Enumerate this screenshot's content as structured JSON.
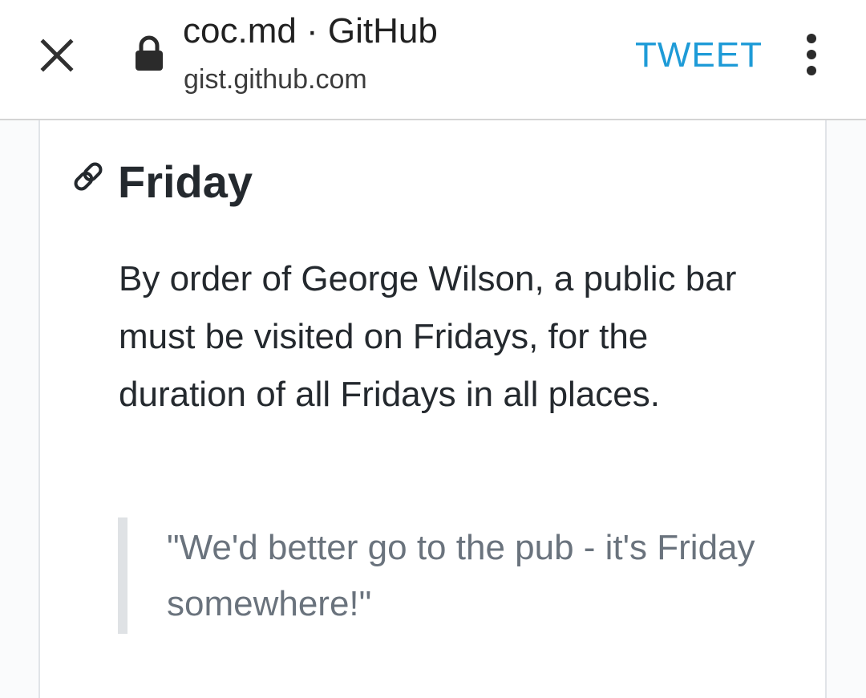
{
  "appbar": {
    "close_icon": "close-icon",
    "lock_icon": "lock-icon",
    "title": "coc.md · GitHub",
    "url": "gist.github.com",
    "tweet_label": "TWEET",
    "menu_icon": "more-vert-icon",
    "accent_color": "#1e9bd7"
  },
  "content": {
    "anchor_icon": "link-icon",
    "heading": "Friday",
    "paragraph": "By order of George Wilson, a public bar must be visited on Fridays, for the duration of all Fridays in all places.",
    "blockquote": "\"We'd better go to the pub - it's Friday somewhere!\""
  }
}
